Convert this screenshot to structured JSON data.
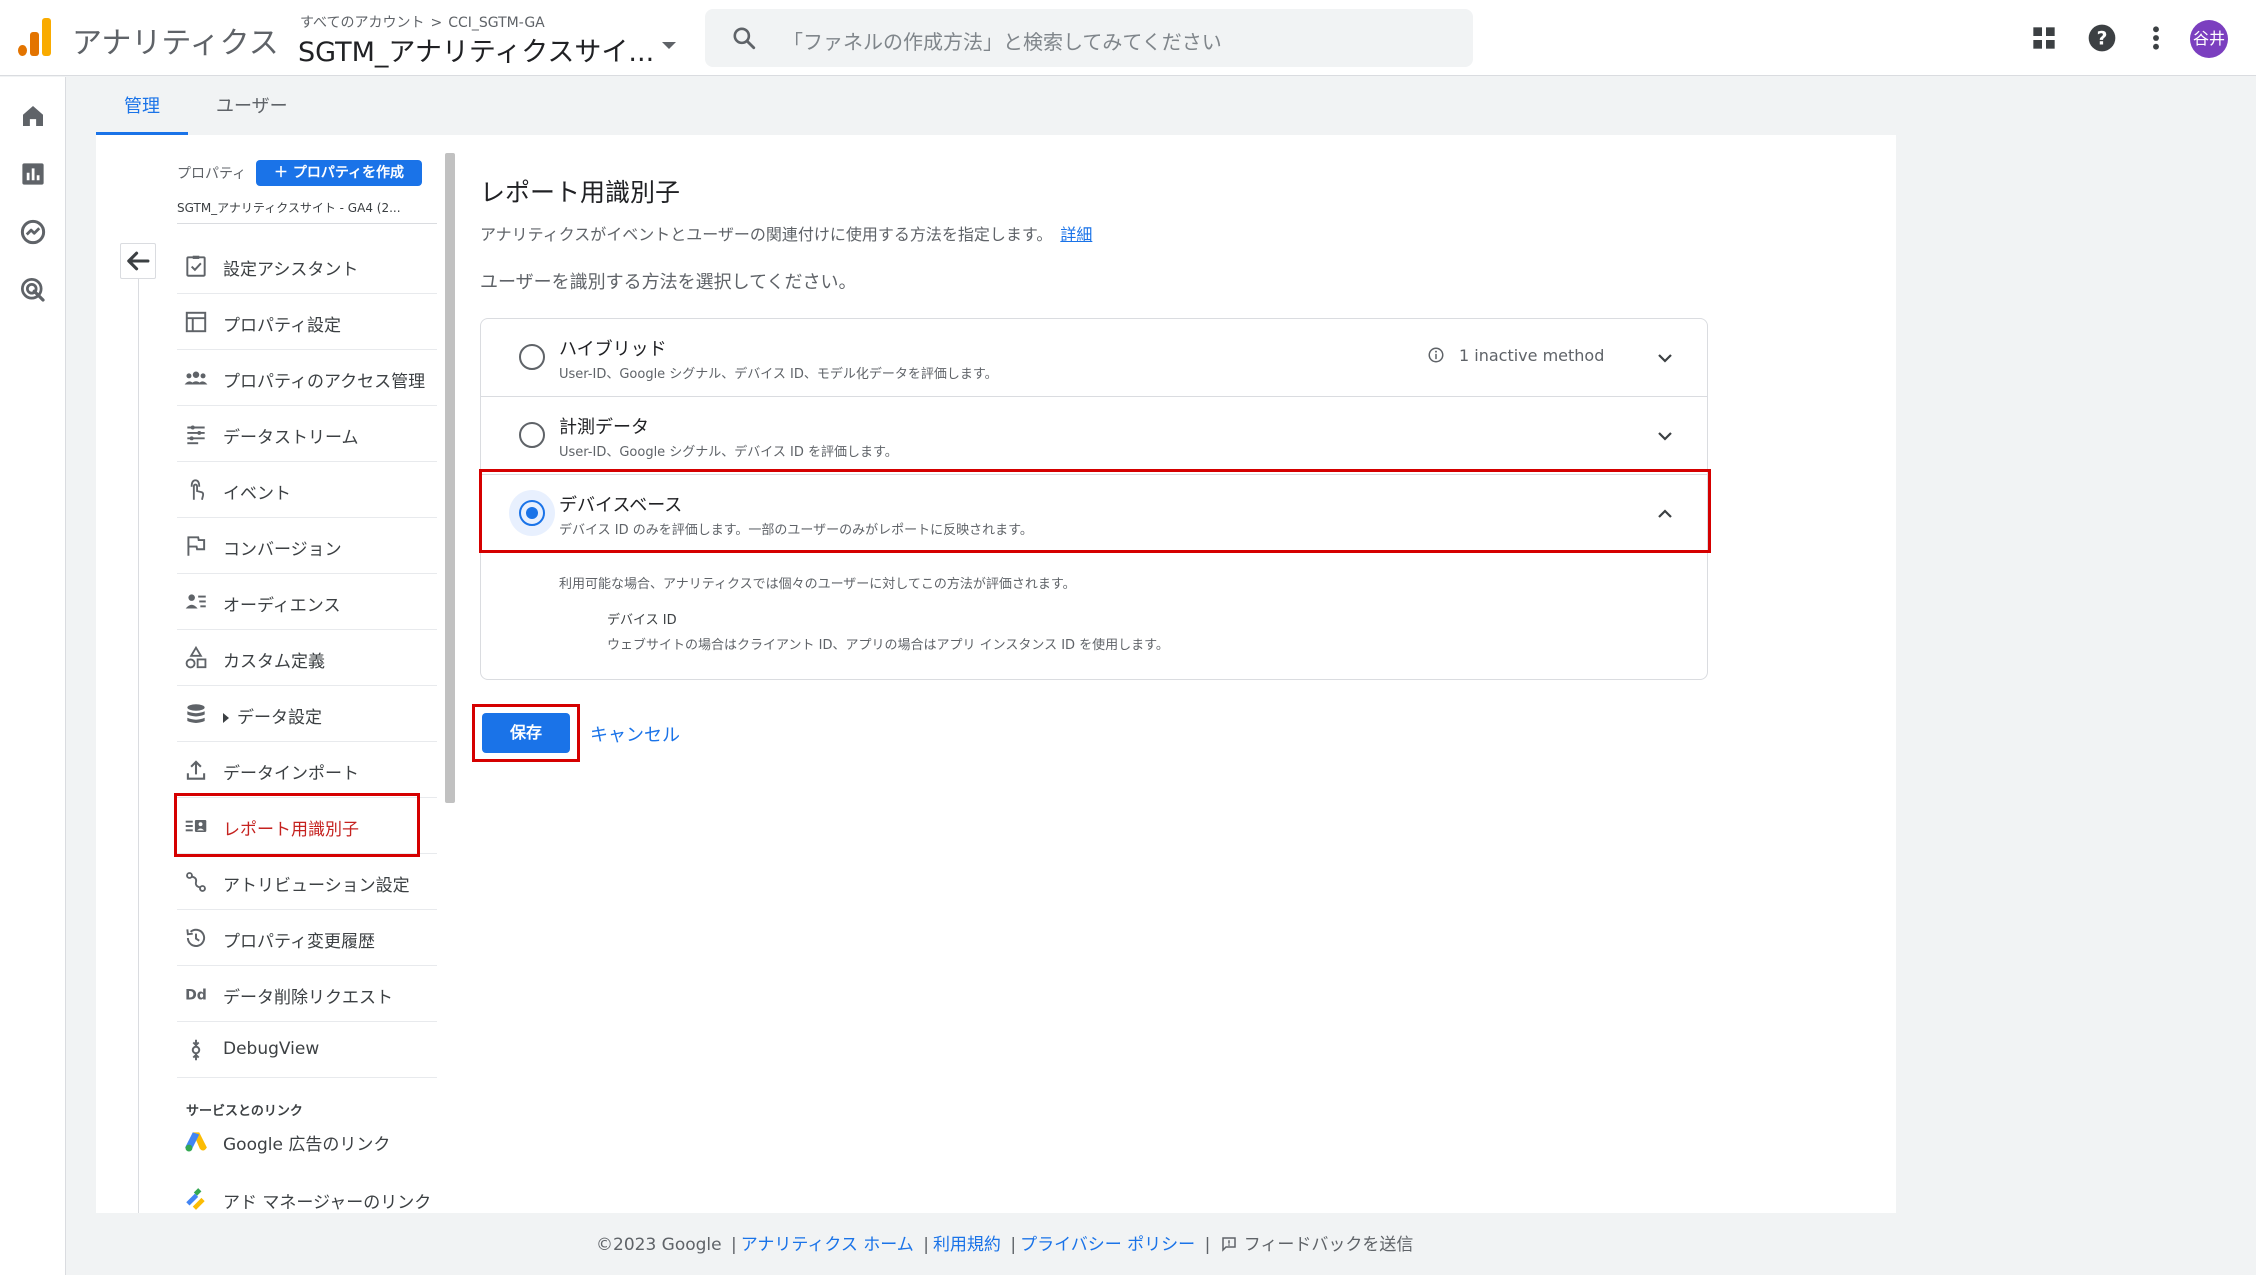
{
  "header": {
    "app_name": "アナリティクス",
    "breadcrumb_root": "すべてのアカウント",
    "breadcrumb_sep": ">",
    "breadcrumb_account": "CCI_SGTM-GA",
    "property_title": "SGTM_アナリティクスサイ...",
    "search_placeholder": "「ファネルの作成方法」と検索してみてください",
    "avatar_text": "谷井",
    "colors": {
      "logo_dark": "#e37400",
      "logo_light": "#f9ab00",
      "accent": "#1a73e8",
      "avatar": "#7b3fbf"
    }
  },
  "rail": {
    "icons": [
      "home-icon",
      "reports-icon",
      "explore-icon",
      "advertising-icon",
      "admin-gear-icon"
    ]
  },
  "tabs": [
    {
      "label": "管理",
      "active": true
    },
    {
      "label": "ユーザー",
      "active": false
    }
  ],
  "admin_nav": {
    "property_label": "プロパティ",
    "create_button": "＋ プロパティを作成",
    "property_name": "SGTM_アナリティクスサイト - GA4 (2...",
    "items": [
      {
        "label": "設定アシスタント",
        "icon": "checklist-icon"
      },
      {
        "label": "プロパティ設定",
        "icon": "property-settings-icon"
      },
      {
        "label": "プロパティのアクセス管理",
        "icon": "people-icon"
      },
      {
        "label": "データストリーム",
        "icon": "data-stream-icon"
      },
      {
        "label": "イベント",
        "icon": "touch-icon"
      },
      {
        "label": "コンバージョン",
        "icon": "flag-icon"
      },
      {
        "label": "オーディエンス",
        "icon": "audience-icon"
      },
      {
        "label": "カスタム定義",
        "icon": "shapes-icon"
      },
      {
        "label": "データ設定",
        "icon": "database-icon"
      },
      {
        "label": "データインポート",
        "icon": "upload-icon"
      },
      {
        "label": "レポート用識別子",
        "icon": "reporting-id-icon",
        "active": true
      },
      {
        "label": "アトリビューション設定",
        "icon": "attribution-icon"
      },
      {
        "label": "プロパティ変更履歴",
        "icon": "history-icon"
      },
      {
        "label": "データ削除リクエスト",
        "icon": "dd-icon"
      },
      {
        "label": "DebugView",
        "icon": "debug-icon"
      }
    ],
    "section_label": "サービスとのリンク",
    "link_items": [
      {
        "label": "Google 広告のリンク",
        "icon": "google-ads-icon"
      },
      {
        "label": "アド マネージャーのリンク",
        "icon": "ad-manager-icon"
      }
    ]
  },
  "content": {
    "title": "レポート用識別子",
    "description": "アナリティクスがイベントとユーザーの関連付けに使用する方法を指定します。",
    "details_link": "詳細",
    "prompt": "ユーザーを識別する方法を選択してください。",
    "options": [
      {
        "title": "ハイブリッド",
        "subtitle": "User-ID、Google シグナル、デバイス ID、モデル化データを評価します。",
        "note": "1 inactive method",
        "selected": false
      },
      {
        "title": "計測データ",
        "subtitle": "User-ID、Google シグナル、デバイス ID を評価します。",
        "selected": false
      },
      {
        "title": "デバイスベース",
        "subtitle": "デバイス ID のみを評価します。一部のユーザーのみがレポートに反映されます。",
        "selected": true
      }
    ],
    "expanded": {
      "intro": "利用可能な場合、アナリティクスでは個々のユーザーに対してこの方法が評価されます。",
      "term": "デバイス ID",
      "definition": "ウェブサイトの場合はクライアント ID、アプリの場合はアプリ インスタンス ID を使用します。"
    },
    "save_label": "保存",
    "cancel_label": "キャンセル"
  },
  "footer": {
    "copyright": "©2023 Google",
    "sep": "|",
    "links": [
      "アナリティクス ホーム",
      "利用規約",
      "プライバシー ポリシー"
    ],
    "feedback": "フィードバックを送信"
  }
}
